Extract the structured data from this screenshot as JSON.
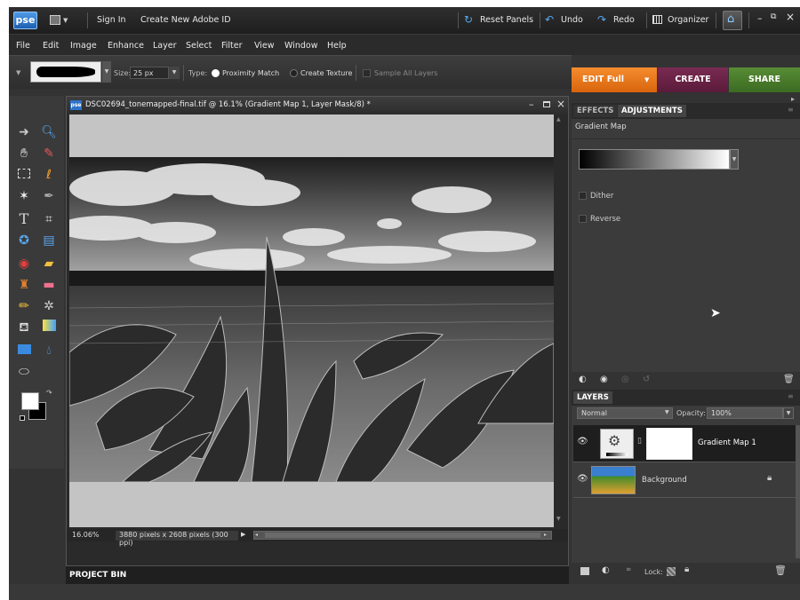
{
  "app": {
    "logo": "pse",
    "sign_in": "Sign In",
    "create_id": "Create New Adobe ID"
  },
  "toolbar": {
    "reset_panels": "Reset Panels",
    "undo": "Undo",
    "redo": "Redo",
    "organizer": "Organizer"
  },
  "window_controls": {
    "minimize": "–",
    "restore": "⧉",
    "close": "×"
  },
  "menu": [
    "File",
    "Edit",
    "Image",
    "Enhance",
    "Layer",
    "Select",
    "Filter",
    "View",
    "Window",
    "Help"
  ],
  "options": {
    "size_label": "Size:",
    "size_value": "25 px",
    "type_label": "Type:",
    "proximity": "Proximity Match",
    "create_texture": "Create Texture",
    "sample_all": "Sample All Layers"
  },
  "modes": {
    "edit": "EDIT Full",
    "create": "CREATE",
    "share": "SHARE"
  },
  "document": {
    "title": "DSC02694_tonemapped-final.tif @ 16.1% (Gradient Map 1, Layer Mask/8) *",
    "icon": "pse",
    "zoom": "16.06%",
    "info": "3880 pixels x 2608 pixels (300 ppi)"
  },
  "project_bin": "PROJECT BIN",
  "adjustments": {
    "tab_effects": "EFFECTS",
    "tab_adjustments": "ADJUSTMENTS",
    "heading": "Gradient Map",
    "dither": "Dither",
    "reverse": "Reverse"
  },
  "layers": {
    "tab": "LAYERS",
    "blend_mode": "Normal",
    "opacity_label": "Opacity:",
    "opacity_value": "100%",
    "items": [
      {
        "name": "Gradient Map 1"
      },
      {
        "name": "Background"
      }
    ],
    "lock_label": "Lock:"
  },
  "colors": {
    "edit_tab": "#f07b1d",
    "create_tab": "#6f2348",
    "share_tab": "#4b7a2c",
    "accent_blue": "#4a9ae8"
  }
}
